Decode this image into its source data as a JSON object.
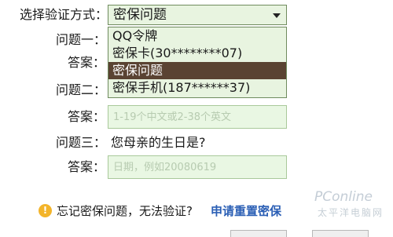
{
  "verify": {
    "label": "选择验证方式：",
    "selected": "密保问题",
    "options": [
      "QQ令牌",
      "密保卡(30********07)",
      "密保问题",
      "密保手机(187******37)"
    ],
    "selected_index": 2
  },
  "question1": {
    "label": "问题一：",
    "answer_label": "答案："
  },
  "question2": {
    "label": "问题二：",
    "answer_label": "答案：",
    "placeholder": "1-19个中文或2-38个英文"
  },
  "question3": {
    "label": "问题三：",
    "text": "您母亲的生日是?",
    "answer_label": "答案：",
    "placeholder": "日期，例如20080619"
  },
  "footer": {
    "forgot_text": "忘记密保问题，无法验证?",
    "reset_link": "申请重置密保"
  },
  "watermark": {
    "brand": "PConline",
    "sub": "太平洋电脑网"
  },
  "colors": {
    "field_bg": "#e9f7e3",
    "selected_option_bg": "#5a4332",
    "link": "#2b5fb5",
    "warning": "#f3b42a"
  }
}
